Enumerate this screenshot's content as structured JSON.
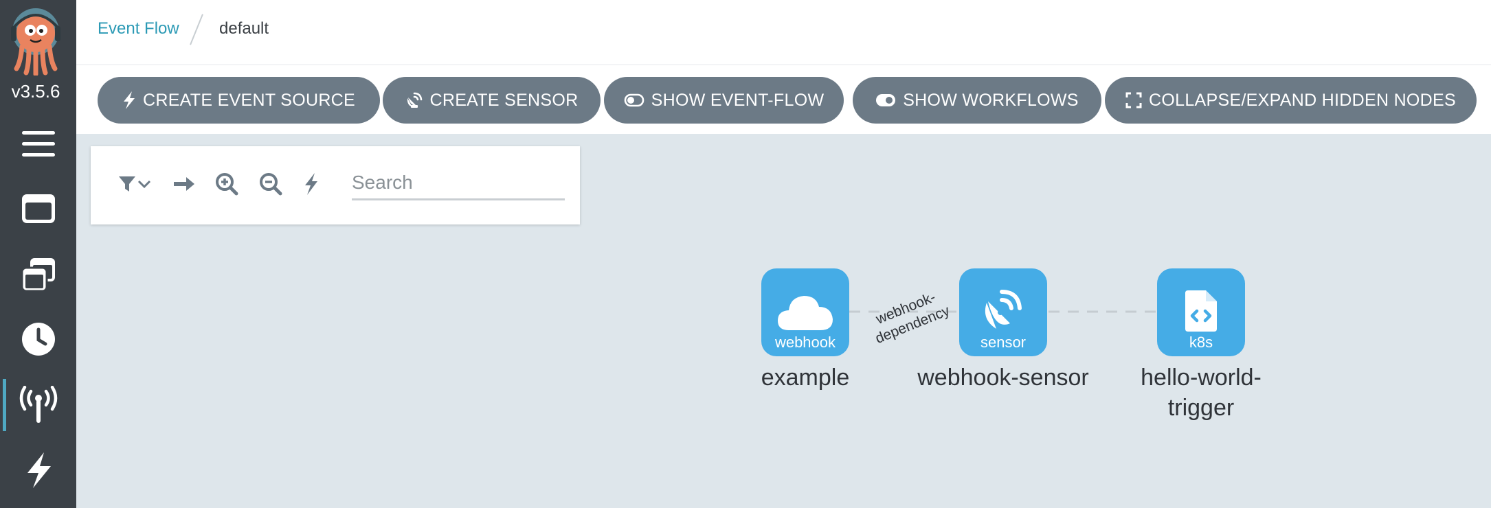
{
  "sidebar": {
    "version": "v3.5.6",
    "items": [
      {
        "name": "menu-icon",
        "active": false
      },
      {
        "name": "workflow-templates-icon",
        "active": false
      },
      {
        "name": "cluster-templates-icon",
        "active": false
      },
      {
        "name": "cron-workflows-icon",
        "active": false
      },
      {
        "name": "event-flow-icon",
        "active": true
      },
      {
        "name": "event-sources-icon",
        "active": false
      }
    ]
  },
  "breadcrumb": {
    "parent": "Event Flow",
    "current": "default"
  },
  "actions": [
    {
      "label": "CREATE EVENT SOURCE",
      "icon": "bolt-icon"
    },
    {
      "label": "CREATE SENSOR",
      "icon": "satellite-dish-icon"
    },
    {
      "label": "SHOW EVENT-FLOW",
      "icon": "toggle-off-icon"
    },
    {
      "label": "SHOW WORKFLOWS",
      "icon": "toggle-on-icon"
    },
    {
      "label": "COLLAPSE/EXPAND HIDDEN NODES",
      "icon": "expand-icon"
    }
  ],
  "toolbar": {
    "search_placeholder": "Search",
    "icons": [
      "filter-icon",
      "chevron-down-icon",
      "arrow-right-icon",
      "zoom-in-icon",
      "zoom-out-icon",
      "bolt-icon"
    ]
  },
  "graph": {
    "nodes": [
      {
        "id": "example",
        "type": "webhook",
        "label": "example",
        "icon": "cloud-icon"
      },
      {
        "id": "webhook-sensor",
        "type": "sensor",
        "label": "webhook-sensor",
        "icon": "satellite-dish-icon"
      },
      {
        "id": "hello-world-trigger",
        "type": "k8s",
        "label": "hello-world-trigger",
        "label_lines": [
          "hello-world-",
          "trigger"
        ],
        "icon": "file-code-icon"
      }
    ],
    "edges": [
      {
        "from": "example",
        "to": "webhook-sensor",
        "label_lines": [
          "webhook-",
          "dependency"
        ]
      },
      {
        "from": "webhook-sensor",
        "to": "hello-world-trigger",
        "label_lines": []
      }
    ]
  },
  "colors": {
    "sidebar": "#3b4147",
    "accent": "#4fa9c3",
    "breadcrumb_link": "#2c9ab5",
    "button": "#6c7a86",
    "node": "#45ace6",
    "canvas": "#dee6eb"
  }
}
